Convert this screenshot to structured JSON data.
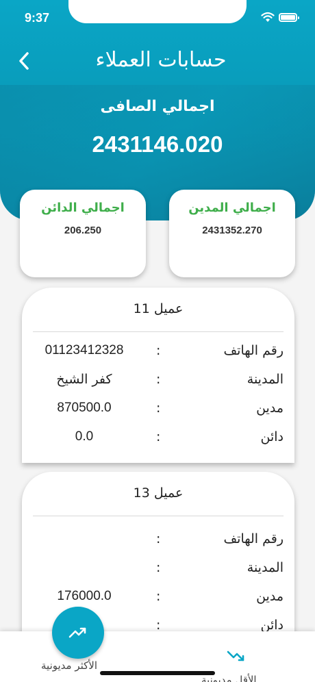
{
  "status_bar": {
    "time": "9:37"
  },
  "header": {
    "title": "حسابات العملاء"
  },
  "net_total": {
    "label": "اجمالي الصافى",
    "value": "2431146.020"
  },
  "summary": {
    "creditor": {
      "label": "اجمالي الدائن",
      "value": "206.250"
    },
    "debtor": {
      "label": "اجمالي المدين",
      "value": "2431352.270"
    }
  },
  "customers": [
    {
      "name": "عميل 11",
      "rows": [
        {
          "label": "رقم الهاتف",
          "value": "01123412328"
        },
        {
          "label": "المدينة",
          "value": "كفر الشيخ"
        },
        {
          "label": "مدين",
          "value": "870500.0"
        },
        {
          "label": "دائن",
          "value": "0.0"
        }
      ]
    },
    {
      "name": "عميل 13",
      "rows": [
        {
          "label": "رقم الهاتف",
          "value": ""
        },
        {
          "label": "المدينة",
          "value": ""
        },
        {
          "label": "مدين",
          "value": "176000.0"
        },
        {
          "label": "دائن",
          "value": ""
        }
      ]
    }
  ],
  "colon": ":",
  "bottom_nav": {
    "most_debt": "الأكثر مديونية",
    "least_debt": "الأقل مديونية"
  },
  "icons": {
    "back": "chevron-left-icon",
    "most_debt": "trending-up-icon",
    "least_debt": "trending-down-icon"
  },
  "colors": {
    "primary": "#0aa6c6",
    "accent_green": "#3fae4b"
  }
}
